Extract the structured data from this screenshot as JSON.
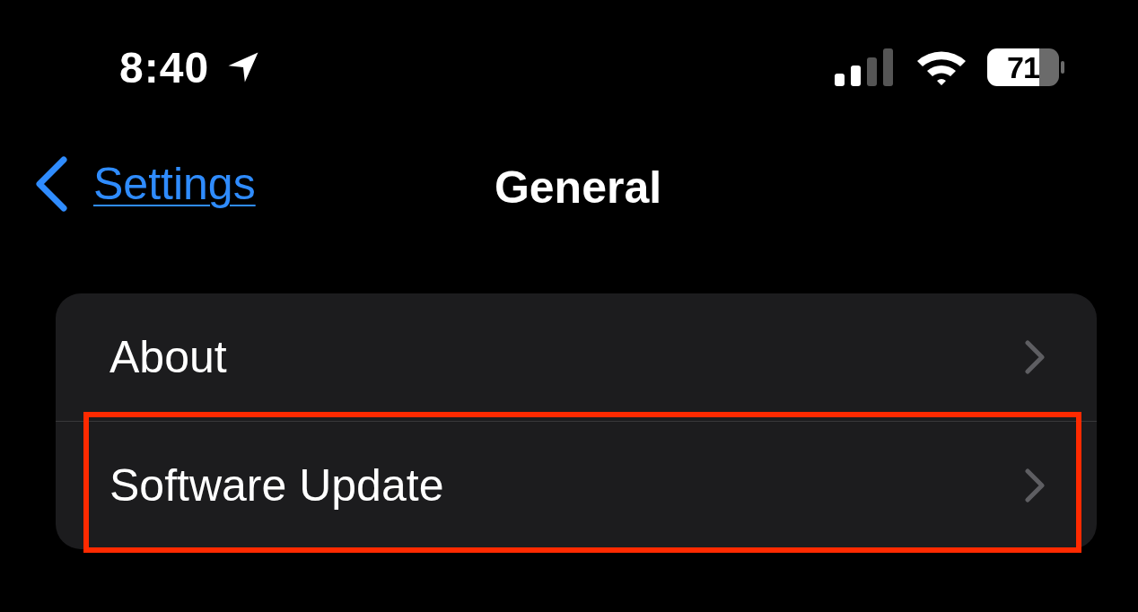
{
  "status_bar": {
    "time": "8:40",
    "battery": "71"
  },
  "nav": {
    "back": "Settings",
    "title": "General"
  },
  "items": [
    {
      "label": "About",
      "highlighted": false
    },
    {
      "label": "Software Update",
      "highlighted": true
    }
  ]
}
